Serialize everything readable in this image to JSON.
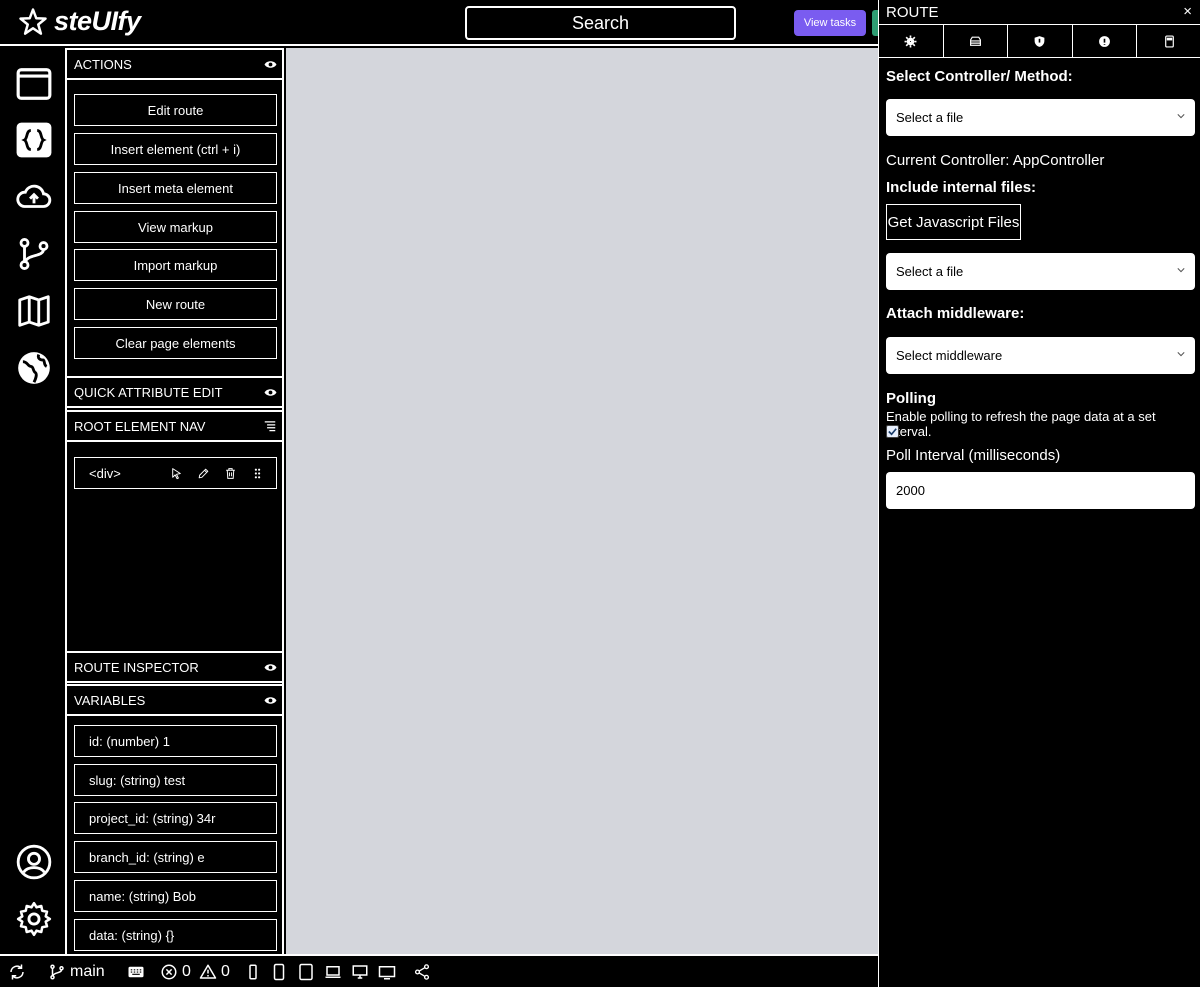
{
  "app": {
    "name": "steUIfy"
  },
  "header": {
    "search_label": "Search",
    "view_tasks_label": "View tasks"
  },
  "rail": {
    "icons": [
      "window-icon",
      "code-braces-icon",
      "cloud-upload-icon",
      "git-branch-icon",
      "map-icon",
      "globe-icon",
      "user-circle-icon",
      "settings-icon"
    ]
  },
  "sidebar": {
    "actions_title": "ACTIONS",
    "actions": [
      "Edit route",
      "Insert element (ctrl + i)",
      "Insert meta element",
      "View markup",
      "Import markup",
      "New route",
      "Clear page elements"
    ],
    "quick_attr_title": "QUICK ATTRIBUTE EDIT",
    "root_nav_title": "ROOT ELEMENT NAV",
    "root_node": "<div>",
    "route_inspector_title": "ROUTE INSPECTOR",
    "variables_title": "VARIABLES",
    "variables": [
      "id: (number) 1",
      "slug: (string) test",
      "project_id: (string) 34r",
      "branch_id: (string) e",
      "name: (string) Bob",
      "data: (string) {}"
    ]
  },
  "route_panel": {
    "title": "ROUTE",
    "close": "×",
    "tabs": [
      "settings-icon",
      "database-icon",
      "shield-icon",
      "info-icon",
      "server-icon"
    ],
    "controller_label": "Select Controller/ Method:",
    "controller_select": "Select a file",
    "current_controller": "Current Controller: AppController",
    "internal_files_label": "Include internal files:",
    "js_button": "Get Javascript Files",
    "file_select": "Select a file",
    "middleware_label": "Attach middleware:",
    "middleware_select": "Select middleware",
    "polling_label": "Polling",
    "polling_desc": "Enable polling to refresh the page data at a set interval.",
    "polling_enabled": true,
    "interval_label": "Poll Interval (milliseconds)",
    "interval_value": "2000"
  },
  "statusbar": {
    "branch": "main",
    "errors": "0",
    "warnings": "0"
  },
  "colors": {
    "accent": "#7a5cf0",
    "canvas": "#d4d6dc",
    "green": "#2e9d73"
  }
}
